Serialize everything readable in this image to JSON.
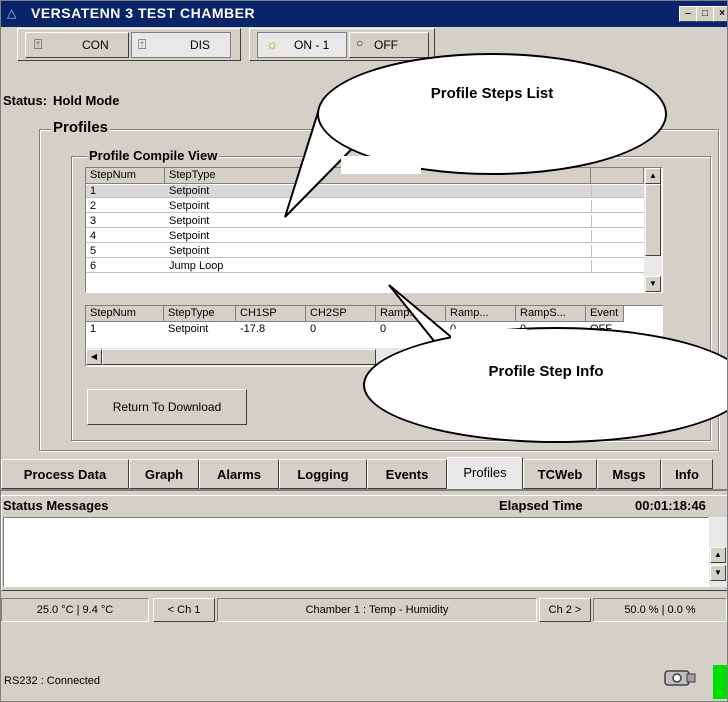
{
  "window": {
    "title": "VERSATENN 3 TEST CHAMBER"
  },
  "toolbar": {
    "con_label": "CON",
    "dis_label": "DIS",
    "on_label": "ON - 1",
    "off_label": "OFF"
  },
  "status": {
    "label": "Status:",
    "value": "Hold Mode"
  },
  "profiles": {
    "group_label": "Profiles",
    "compile_label": "Profile Compile View",
    "steps": {
      "headers": [
        "StepNum",
        "StepType"
      ],
      "rows": [
        [
          "1",
          "Setpoint"
        ],
        [
          "2",
          "Setpoint"
        ],
        [
          "3",
          "Setpoint"
        ],
        [
          "4",
          "Setpoint"
        ],
        [
          "5",
          "Setpoint"
        ],
        [
          "6",
          "Jump Loop"
        ]
      ],
      "selected_row": 0
    },
    "info": {
      "headers": [
        "StepNum",
        "StepType",
        "CH1SP",
        "CH2SP",
        "Ramp...",
        "Ramp...",
        "RampS...",
        "Event"
      ],
      "row": [
        "1",
        "Setpoint",
        "-17.8",
        "0",
        "0",
        "0",
        "0",
        "OFF"
      ]
    },
    "return_button": "Return To Download"
  },
  "callouts": {
    "steps_list": "Profile Steps List",
    "step_info": "Profile Step Info"
  },
  "tabs": [
    {
      "label": "Process Data"
    },
    {
      "label": "Graph"
    },
    {
      "label": "Alarms"
    },
    {
      "label": "Logging"
    },
    {
      "label": "Events"
    },
    {
      "label": "Profiles",
      "active": true
    },
    {
      "label": "TCWeb"
    },
    {
      "label": "Msgs"
    },
    {
      "label": "Info"
    }
  ],
  "messages": {
    "label": "Status Messages",
    "elapsed_label": "Elapsed Time",
    "elapsed_value": "00:01:18:46"
  },
  "statusbar": {
    "ch1_temps": "25.0 °C  |  9.4 °C",
    "ch1_btn": "< Ch 1",
    "chamber": "Chamber 1 : Temp - Humidity",
    "ch2_btn": "Ch 2 >",
    "ch2_values": "50.0 %  |  0.0 %"
  },
  "footer": {
    "connection": "RS232 : Connected"
  }
}
